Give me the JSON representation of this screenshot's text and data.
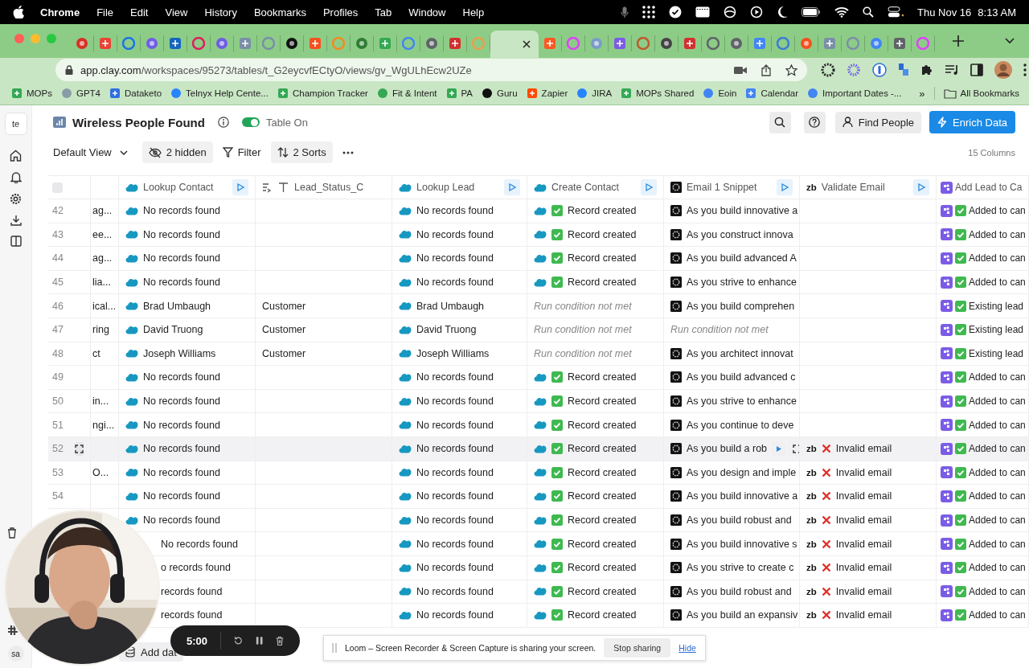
{
  "menubar": {
    "app_name": "Chrome",
    "menus": [
      "File",
      "Edit",
      "View",
      "History",
      "Bookmarks",
      "Profiles",
      "Tab",
      "Window",
      "Help"
    ],
    "date": "Thu Nov 16",
    "time": "8:13 AM"
  },
  "browser": {
    "tabs": [
      {
        "selected": false
      },
      {
        "selected": false
      },
      {
        "selected": false
      },
      {
        "selected": false
      },
      {
        "selected": false
      },
      {
        "selected": false
      },
      {
        "selected": false
      },
      {
        "selected": false
      },
      {
        "selected": false
      },
      {
        "selected": false
      },
      {
        "selected": false
      },
      {
        "selected": false
      },
      {
        "selected": false
      },
      {
        "selected": false
      },
      {
        "selected": false
      },
      {
        "selected": false
      },
      {
        "selected": false
      },
      {
        "selected": false
      },
      {
        "selected": true
      },
      {
        "selected": false
      },
      {
        "selected": false
      },
      {
        "selected": false
      },
      {
        "selected": false
      },
      {
        "selected": false
      },
      {
        "selected": false
      },
      {
        "selected": false
      },
      {
        "selected": false
      },
      {
        "selected": false
      },
      {
        "selected": false
      },
      {
        "selected": false
      },
      {
        "selected": false
      },
      {
        "selected": false
      },
      {
        "selected": false
      },
      {
        "selected": false
      },
      {
        "selected": false
      },
      {
        "selected": false
      }
    ],
    "url": {
      "host": "app.clay.com",
      "path": "/workspaces/95273/tables/t_G2eycvfECtyO/views/gv_WgULhEcw2UZe"
    },
    "bookmarks": [
      "MOPs",
      "GPT4",
      "Dataketo",
      "Telnyx Help Cente...",
      "Champion Tracker",
      "Fit & Intent",
      "PA",
      "Guru",
      "Zapier",
      "JIRA",
      "MOPs Shared",
      "Eoin",
      "Calendar",
      "Important Dates -..."
    ],
    "more": "»",
    "all_bookmarks": "All Bookmarks"
  },
  "sidebar": {
    "workspace": "te",
    "user": "sa"
  },
  "header": {
    "title": "Wireless People Found",
    "toggle": {
      "label": "Table On",
      "on": true
    },
    "find": "Find People",
    "enrich": "Enrich Data"
  },
  "toolbar": {
    "view": "Default View",
    "hidden": "2 hidden",
    "filter": "Filter",
    "sorts": "2 Sorts",
    "column_count": "15 Columns"
  },
  "table": {
    "select_all": {
      "checked": false
    },
    "columns": [
      {
        "kind": "partial"
      },
      {
        "label": "Lookup Contact",
        "kind": "salesforce",
        "runnable": true
      },
      {
        "label": "Lead_Status_C",
        "kind": "text",
        "runnable": false
      },
      {
        "label": "Lookup Lead",
        "kind": "salesforce",
        "runnable": true
      },
      {
        "label": "Create Contact",
        "kind": "salesforce",
        "runnable": true
      },
      {
        "label": "Email 1 Snippet",
        "kind": "gpt",
        "runnable": true
      },
      {
        "label": "Validate Email",
        "kind": "zerobounce",
        "badge": "zb",
        "runnable": true
      },
      {
        "label": "Add Lead to Ca",
        "kind": "app",
        "runnable": false
      }
    ],
    "rows": [
      {
        "number": "42",
        "hovered": false,
        "cells": [
          {
            "text": "ag...",
            "kind": "plain"
          },
          {
            "text": "No records found",
            "kind": "value"
          },
          null,
          {
            "text": "No records found",
            "kind": "value"
          },
          {
            "text": "Record created",
            "kind": "check"
          },
          {
            "text": "As you build innovative a",
            "kind": "value"
          },
          null,
          {
            "text": "Added to can",
            "kind": "check"
          }
        ]
      },
      {
        "number": "43",
        "hovered": false,
        "cells": [
          {
            "text": "ee...",
            "kind": "plain"
          },
          {
            "text": "No records found",
            "kind": "value"
          },
          null,
          {
            "text": "No records found",
            "kind": "value"
          },
          {
            "text": "Record created",
            "kind": "check"
          },
          {
            "text": "As you construct innova",
            "kind": "value"
          },
          null,
          {
            "text": "Added to can",
            "kind": "check"
          }
        ]
      },
      {
        "number": "44",
        "hovered": false,
        "cells": [
          {
            "text": "ag...",
            "kind": "plain"
          },
          {
            "text": "No records found",
            "kind": "value"
          },
          null,
          {
            "text": "No records found",
            "kind": "value"
          },
          {
            "text": "Record created",
            "kind": "check"
          },
          {
            "text": "As you build advanced A",
            "kind": "value"
          },
          null,
          {
            "text": "Added to can",
            "kind": "check"
          }
        ]
      },
      {
        "number": "45",
        "hovered": false,
        "cells": [
          {
            "text": "lia...",
            "kind": "plain"
          },
          {
            "text": "No records found",
            "kind": "value"
          },
          null,
          {
            "text": "No records found",
            "kind": "value"
          },
          {
            "text": "Record created",
            "kind": "check"
          },
          {
            "text": "As you strive to enhance",
            "kind": "value"
          },
          null,
          {
            "text": "Added to can",
            "kind": "check"
          }
        ]
      },
      {
        "number": "46",
        "hovered": false,
        "cells": [
          {
            "text": "ical...",
            "kind": "plain"
          },
          {
            "text": "Brad Umbaugh",
            "kind": "value"
          },
          {
            "text": "Customer",
            "kind": "plain"
          },
          {
            "text": "Brad Umbaugh",
            "kind": "value"
          },
          {
            "text": "Run condition not met",
            "kind": "skipped"
          },
          {
            "text": "As you build comprehen",
            "kind": "value"
          },
          null,
          {
            "text": "Existing lead",
            "kind": "check"
          }
        ]
      },
      {
        "number": "47",
        "hovered": false,
        "cells": [
          {
            "text": "ring",
            "kind": "plain"
          },
          {
            "text": "David Truong",
            "kind": "value"
          },
          {
            "text": "Customer",
            "kind": "plain"
          },
          {
            "text": "David Truong",
            "kind": "value"
          },
          {
            "text": "Run condition not met",
            "kind": "skipped"
          },
          {
            "text": "Run condition not met",
            "kind": "skipped"
          },
          null,
          {
            "text": "Existing lead",
            "kind": "check"
          }
        ]
      },
      {
        "number": "48",
        "hovered": false,
        "cells": [
          {
            "text": "ct",
            "kind": "plain"
          },
          {
            "text": "Joseph Williams",
            "kind": "value"
          },
          {
            "text": "Customer",
            "kind": "plain"
          },
          {
            "text": "Joseph Williams",
            "kind": "value"
          },
          {
            "text": "Run condition not met",
            "kind": "skipped"
          },
          {
            "text": "As you architect innovat",
            "kind": "value"
          },
          null,
          {
            "text": "Existing lead",
            "kind": "check"
          }
        ]
      },
      {
        "number": "49",
        "hovered": false,
        "cells": [
          null,
          {
            "text": "No records found",
            "kind": "value"
          },
          null,
          {
            "text": "No records found",
            "kind": "value"
          },
          {
            "text": "Record created",
            "kind": "check"
          },
          {
            "text": "As you build advanced c",
            "kind": "value"
          },
          null,
          {
            "text": "Added to can",
            "kind": "check"
          }
        ]
      },
      {
        "number": "50",
        "hovered": false,
        "cells": [
          {
            "text": "in...",
            "kind": "plain"
          },
          {
            "text": "No records found",
            "kind": "value"
          },
          null,
          {
            "text": "No records found",
            "kind": "value"
          },
          {
            "text": "Record created",
            "kind": "check"
          },
          {
            "text": "As you strive to enhance",
            "kind": "value"
          },
          null,
          {
            "text": "Added to can",
            "kind": "check"
          }
        ]
      },
      {
        "number": "51",
        "hovered": false,
        "cells": [
          {
            "text": "ngi...",
            "kind": "plain"
          },
          {
            "text": "No records found",
            "kind": "value"
          },
          null,
          {
            "text": "No records found",
            "kind": "value"
          },
          {
            "text": "Record created",
            "kind": "check"
          },
          {
            "text": "As you continue to deve",
            "kind": "value"
          },
          null,
          {
            "text": "Added to can",
            "kind": "check"
          }
        ]
      },
      {
        "number": "52",
        "hovered": true,
        "cells": [
          null,
          {
            "text": "No records found",
            "kind": "value"
          },
          null,
          {
            "text": "No records found",
            "kind": "value"
          },
          {
            "text": "Record created",
            "kind": "check"
          },
          {
            "text": "As you build a rob",
            "kind": "value"
          },
          {
            "text": "Invalid email",
            "kind": "cross",
            "badge": "zb"
          },
          {
            "text": "Added to can",
            "kind": "check"
          }
        ]
      },
      {
        "number": "53",
        "hovered": false,
        "cells": [
          {
            "text": "O...",
            "kind": "plain"
          },
          {
            "text": "No records found",
            "kind": "value"
          },
          null,
          {
            "text": "No records found",
            "kind": "value"
          },
          {
            "text": "Record created",
            "kind": "check"
          },
          {
            "text": "As you design and imple",
            "kind": "value"
          },
          {
            "text": "Invalid email",
            "kind": "cross",
            "badge": "zb"
          },
          {
            "text": "Added to can",
            "kind": "check"
          }
        ]
      },
      {
        "number": "54",
        "hovered": false,
        "cells": [
          null,
          {
            "text": "No records found",
            "kind": "value"
          },
          null,
          {
            "text": "No records found",
            "kind": "value"
          },
          {
            "text": "Record created",
            "kind": "check"
          },
          {
            "text": "As you build innovative a",
            "kind": "value"
          },
          {
            "text": "Invalid email",
            "kind": "cross",
            "badge": "zb"
          },
          {
            "text": "Added to can",
            "kind": "check"
          }
        ]
      },
      {
        "hovered": false,
        "cells": [
          null,
          {
            "text": "No records found",
            "kind": "value"
          },
          null,
          {
            "text": "No records found",
            "kind": "value"
          },
          {
            "text": "Record created",
            "kind": "check"
          },
          {
            "text": "As you build robust and",
            "kind": "value"
          },
          {
            "text": "Invalid email",
            "kind": "cross",
            "badge": "zb"
          },
          {
            "text": "Added to can",
            "kind": "check"
          }
        ]
      },
      {
        "hovered": false,
        "cells": [
          null,
          {
            "text": "No records found",
            "kind": "clipped"
          },
          null,
          {
            "text": "No records found",
            "kind": "value"
          },
          {
            "text": "Record created",
            "kind": "check"
          },
          {
            "text": "As you build innovative s",
            "kind": "value"
          },
          {
            "text": "Invalid email",
            "kind": "cross",
            "badge": "zb"
          },
          {
            "text": "Added to can",
            "kind": "check"
          }
        ]
      },
      {
        "hovered": false,
        "cells": [
          null,
          {
            "text": "o records found",
            "kind": "clipped"
          },
          null,
          {
            "text": "No records found",
            "kind": "value"
          },
          {
            "text": "Record created",
            "kind": "check"
          },
          {
            "text": "As you strive to create c",
            "kind": "value"
          },
          {
            "text": "Invalid email",
            "kind": "cross",
            "badge": "zb"
          },
          {
            "text": "Added to can",
            "kind": "check"
          }
        ]
      },
      {
        "hovered": false,
        "cells": [
          null,
          {
            "text": "records found",
            "kind": "clipped"
          },
          null,
          {
            "text": "No records found",
            "kind": "value"
          },
          {
            "text": "Record created",
            "kind": "check"
          },
          {
            "text": "As you build robust and",
            "kind": "value"
          },
          {
            "text": "Invalid email",
            "kind": "cross",
            "badge": "zb"
          },
          {
            "text": "Added to can",
            "kind": "check"
          }
        ]
      },
      {
        "hovered": false,
        "cells": [
          null,
          {
            "text": "records found",
            "kind": "clipped"
          },
          null,
          {
            "text": "No records found",
            "kind": "value"
          },
          {
            "text": "Record created",
            "kind": "check"
          },
          {
            "text": "As you build an expansiv",
            "kind": "value"
          },
          {
            "text": "Invalid email",
            "kind": "cross",
            "badge": "zb"
          },
          {
            "text": "Added to can",
            "kind": "check"
          }
        ]
      }
    ]
  },
  "footer": {
    "add_data": "Add dat"
  },
  "recorder": {
    "timer": "5:00"
  },
  "notice": {
    "text": "Loom – Screen Recorder & Screen Capture is sharing your screen.",
    "stop": "Stop sharing",
    "hide": "Hide"
  }
}
